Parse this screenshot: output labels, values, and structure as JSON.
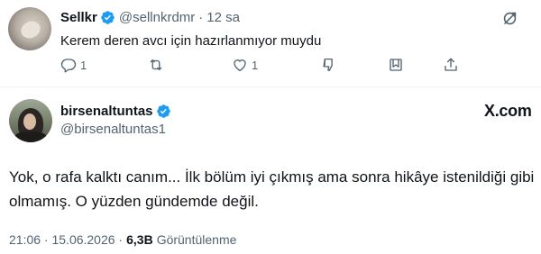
{
  "reply": {
    "name": "Sellkr",
    "handle": "@sellnkrdmr",
    "separator": "·",
    "time": "12 sa",
    "text": "Kerem deren avcı için hazırlanmıyor muydu",
    "actions": {
      "reply_icon": "comment-icon",
      "reply_count": "1",
      "repost_icon": "repost-icon",
      "like_icon": "heart-icon",
      "like_count": "1",
      "stats_icon": "bar-chart-icon",
      "bookmark_icon": "bookmark-icon",
      "share_icon": "share-icon"
    }
  },
  "main_tweet": {
    "name": "birsenaltuntas",
    "handle": "@birsenaltuntas1",
    "brand": "X.com",
    "text": "Yok, o rafa kalktı canım... İlk bölüm iyi çıkmış ama sonra hikâye istenildiği gibi olmamış. O yüzden gündemde değil.",
    "timestamp": "21:06 · 15.06.2026 ·",
    "views_count": "6,3B",
    "views_label": "Görüntülenme"
  },
  "colors": {
    "verified_blue": "#1d9bf0",
    "text_primary": "#0f1419",
    "text_secondary": "#536471",
    "divider": "#eff3f4"
  }
}
